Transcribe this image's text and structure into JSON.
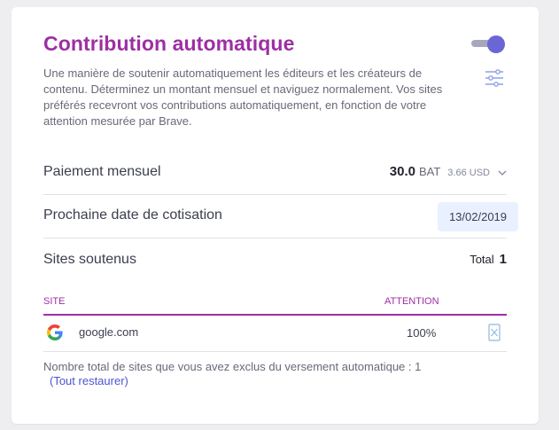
{
  "panel": {
    "title": "Contribution automatique",
    "description": "Une manière de soutenir automatiquement les éditeurs et les créateurs de contenu. Déterminez un montant mensuel et naviguez normalement. Vos sites préférés recevront vos contributions automatiquement, en fonction de votre attention mesurée par Brave.",
    "toggle_on": true,
    "settings_icon": "sliders-icon"
  },
  "monthly": {
    "label": "Paiement mensuel",
    "amount": "30.0",
    "unit": "BAT",
    "usd": "3.66 USD"
  },
  "next_date": {
    "label": "Prochaine date de cotisation",
    "value": "13/02/2019"
  },
  "sites": {
    "label": "Sites soutenus",
    "total_label": "Total",
    "total": "1"
  },
  "table": {
    "headers": [
      "SITE",
      "ATTENTION"
    ],
    "rows": [
      {
        "icon": "google-icon",
        "site": "google.com",
        "attention": "100%"
      }
    ]
  },
  "footer": {
    "excluded_text": "Nombre total de sites que vous avez exclus du versement automatique : 1",
    "restore_link": "(Tout restaurer)"
  },
  "colors": {
    "accent": "#9d2fa4",
    "toggle": "#6a66d6",
    "link": "#4c54d2"
  }
}
